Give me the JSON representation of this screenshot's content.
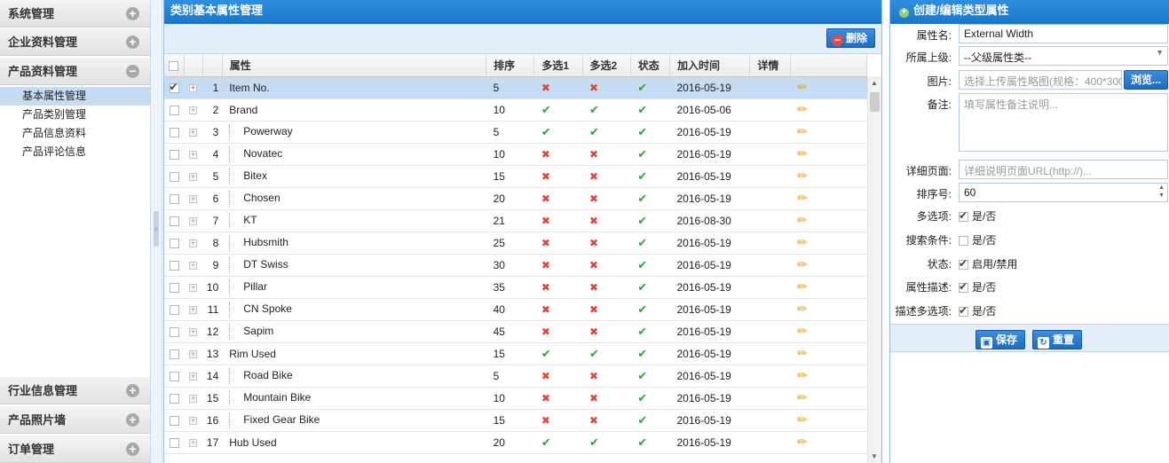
{
  "sidebar": {
    "sections": [
      {
        "label": "系统管理",
        "icon": "plus-circle-icon"
      },
      {
        "label": "企业资料管理",
        "icon": "plus-circle-icon"
      },
      {
        "label": "产品资料管理",
        "icon": "minus-circle-icon"
      },
      {
        "label": "行业信息管理",
        "icon": "plus-circle-icon"
      },
      {
        "label": "产品照片墙",
        "icon": "plus-circle-icon"
      },
      {
        "label": "订单管理",
        "icon": "plus-circle-icon"
      }
    ],
    "sub_items": [
      {
        "label": "基本属性管理",
        "active": true
      },
      {
        "label": "产品类别管理",
        "active": false
      },
      {
        "label": "产品信息资料",
        "active": false
      },
      {
        "label": "产品评论信息",
        "active": false
      }
    ]
  },
  "center": {
    "title": "类别基本属性管理",
    "delete_label": "删除",
    "columns": [
      "属性",
      "排序",
      "多选1",
      "多选2",
      "状态",
      "加入时间",
      "详情"
    ],
    "rows": [
      {
        "num": "1",
        "name": "Item No.",
        "child": false,
        "sort": "5",
        "m1": false,
        "m2": false,
        "status": true,
        "date": "2016-05-19",
        "selected": true
      },
      {
        "num": "2",
        "name": "Brand",
        "child": false,
        "sort": "10",
        "m1": true,
        "m2": true,
        "status": true,
        "date": "2016-05-06",
        "selected": false
      },
      {
        "num": "3",
        "name": "Powerway",
        "child": true,
        "sort": "5",
        "m1": true,
        "m2": true,
        "status": true,
        "date": "2016-05-19",
        "selected": false
      },
      {
        "num": "4",
        "name": "Novatec",
        "child": true,
        "sort": "10",
        "m1": false,
        "m2": false,
        "status": true,
        "date": "2016-05-19",
        "selected": false
      },
      {
        "num": "5",
        "name": "Bitex",
        "child": true,
        "sort": "15",
        "m1": false,
        "m2": false,
        "status": true,
        "date": "2016-05-19",
        "selected": false
      },
      {
        "num": "6",
        "name": "Chosen",
        "child": true,
        "sort": "20",
        "m1": false,
        "m2": false,
        "status": true,
        "date": "2016-05-19",
        "selected": false
      },
      {
        "num": "7",
        "name": "KT",
        "child": true,
        "sort": "21",
        "m1": false,
        "m2": false,
        "status": true,
        "date": "2016-08-30",
        "selected": false
      },
      {
        "num": "8",
        "name": "Hubsmith",
        "child": true,
        "sort": "25",
        "m1": false,
        "m2": false,
        "status": true,
        "date": "2016-05-19",
        "selected": false
      },
      {
        "num": "9",
        "name": "DT Swiss",
        "child": true,
        "sort": "30",
        "m1": false,
        "m2": false,
        "status": true,
        "date": "2016-05-19",
        "selected": false
      },
      {
        "num": "10",
        "name": "Pillar",
        "child": true,
        "sort": "35",
        "m1": false,
        "m2": false,
        "status": true,
        "date": "2016-05-19",
        "selected": false
      },
      {
        "num": "11",
        "name": "CN Spoke",
        "child": true,
        "sort": "40",
        "m1": false,
        "m2": false,
        "status": true,
        "date": "2016-05-19",
        "selected": false
      },
      {
        "num": "12",
        "name": "Sapim",
        "child": true,
        "sort": "45",
        "m1": false,
        "m2": false,
        "status": true,
        "date": "2016-05-19",
        "selected": false
      },
      {
        "num": "13",
        "name": "Rim Used",
        "child": false,
        "sort": "15",
        "m1": true,
        "m2": true,
        "status": true,
        "date": "2016-05-19",
        "selected": false
      },
      {
        "num": "14",
        "name": "Road Bike",
        "child": true,
        "sort": "5",
        "m1": false,
        "m2": false,
        "status": true,
        "date": "2016-05-19",
        "selected": false
      },
      {
        "num": "15",
        "name": "Mountain Bike",
        "child": true,
        "sort": "10",
        "m1": false,
        "m2": false,
        "status": true,
        "date": "2016-05-19",
        "selected": false
      },
      {
        "num": "16",
        "name": "Fixed Gear Bike",
        "child": true,
        "sort": "15",
        "m1": false,
        "m2": false,
        "status": true,
        "date": "2016-05-19",
        "selected": false
      },
      {
        "num": "17",
        "name": "Hub Used",
        "child": false,
        "sort": "20",
        "m1": true,
        "m2": true,
        "status": true,
        "date": "2016-05-19",
        "selected": false
      }
    ]
  },
  "form": {
    "title": "创建/编辑类型属性",
    "name_label": "属性名:",
    "name_value": "External Width",
    "parent_label": "所属上级:",
    "parent_value": "--父级属性类--",
    "image_label": "图片:",
    "image_placeholder": "选择上传属性略图(规格：400*300)",
    "browse_label": "浏览...",
    "note_label": "备注:",
    "note_placeholder": "填写属性备注说明...",
    "detail_label": "详细页面:",
    "detail_placeholder": "详细说明页面URL(http://)...",
    "sort_label": "排序号:",
    "sort_value": "60",
    "multi_label": "多选项:",
    "multi_text": "是/否",
    "multi_checked": true,
    "search_label": "搜索条件:",
    "search_text": "是/否",
    "search_checked": false,
    "status_label": "状态:",
    "status_text": "启用/禁用",
    "status_checked": true,
    "desc_label": "属性描述:",
    "desc_text": "是/否",
    "desc_checked": true,
    "desc_multi_label": "描述多选项:",
    "desc_multi_text": "是/否",
    "desc_multi_checked": true,
    "save_label": "保存",
    "reset_label": "重置"
  },
  "colors": {
    "title_bar": "#1f7fd6",
    "selected_row": "#c5dcf3",
    "check_green": "#2fa63a",
    "cross_red": "#e3443a",
    "button_blue": "#2a7ad4"
  }
}
